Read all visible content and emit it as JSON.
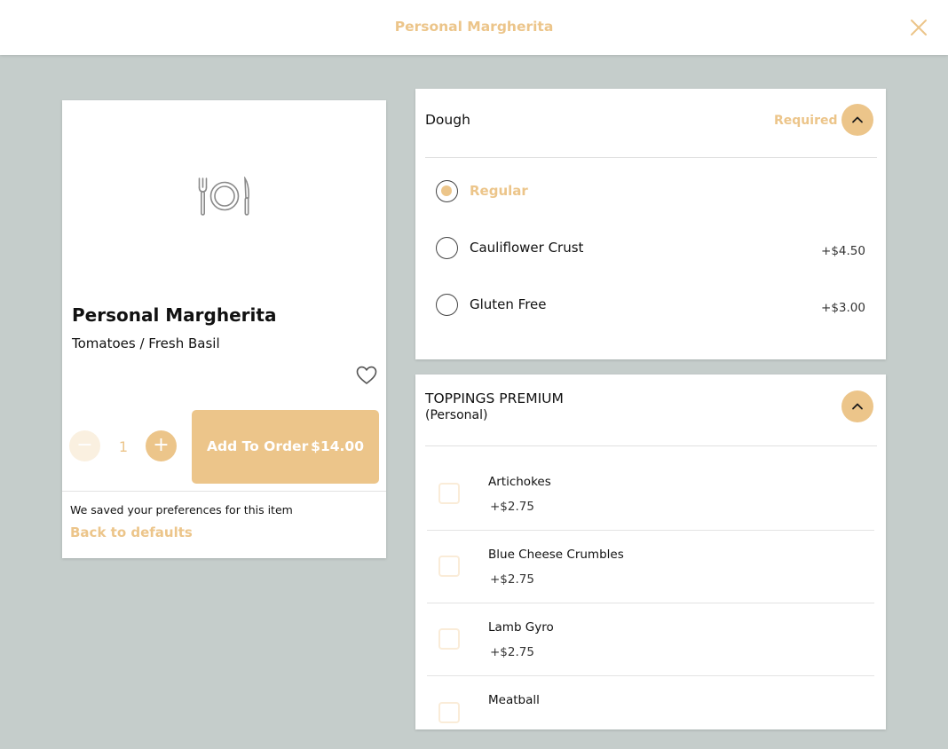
{
  "header": {
    "title": "Personal Margherita",
    "close_icon": "close-icon",
    "accent_color": "#ecc58a"
  },
  "item": {
    "icon": "plate-cutlery-icon",
    "name": "Personal Margherita",
    "description": "Tomatoes / Fresh Basil",
    "favorite_icon": "heart-icon",
    "quantity": "1",
    "minus_symbol": "−",
    "plus_symbol": "+",
    "add_label": "Add To Order",
    "add_price": "$14.00",
    "saved_text": "We saved your preferences for this item",
    "back_link": "Back to defaults"
  },
  "dough": {
    "title": "Dough",
    "required_label": "Required",
    "toggle_icon": "chevron-up-icon",
    "options": [
      {
        "label": "Regular",
        "price": "",
        "selected": true
      },
      {
        "label": "Cauliflower Crust",
        "price": "+$4.50",
        "selected": false
      },
      {
        "label": "Gluten Free",
        "price": "+$3.00",
        "selected": false
      }
    ]
  },
  "toppings": {
    "title": "TOPPINGS PREMIUM",
    "subtitle": "(Personal)",
    "toggle_icon": "chevron-up-icon",
    "items": [
      {
        "name": "Artichokes",
        "price": "+$2.75"
      },
      {
        "name": "Blue Cheese Crumbles",
        "price": "+$2.75"
      },
      {
        "name": "Lamb Gyro",
        "price": "+$2.75"
      },
      {
        "name": "Meatball",
        "price": ""
      }
    ]
  }
}
